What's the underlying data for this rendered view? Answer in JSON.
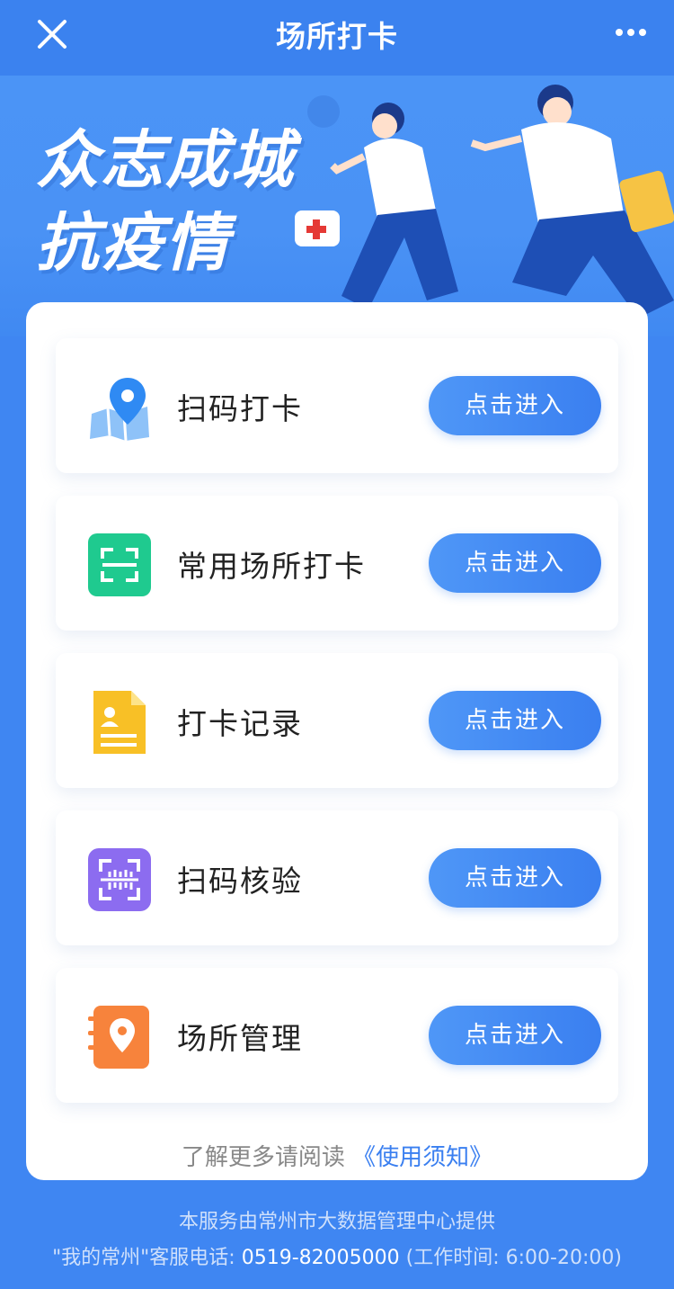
{
  "header": {
    "title": "场所打卡",
    "close_icon": "close-icon",
    "more_icon": "more-icon"
  },
  "banner": {
    "line1": "众志成城",
    "line2": "抗疫情"
  },
  "items": [
    {
      "label": "扫码打卡",
      "button": "点击进入",
      "icon": "map-pin-icon",
      "color": "#3d8ef5"
    },
    {
      "label": "常用场所打卡",
      "button": "点击进入",
      "icon": "scan-frame-icon",
      "color": "#1fca8f"
    },
    {
      "label": "打卡记录",
      "button": "点击进入",
      "icon": "document-icon",
      "color": "#f8c026"
    },
    {
      "label": "扫码核验",
      "button": "点击进入",
      "icon": "qr-verify-icon",
      "color": "#8c6cf0"
    },
    {
      "label": "场所管理",
      "button": "点击进入",
      "icon": "location-book-icon",
      "color": "#f7833c"
    }
  ],
  "notice": {
    "text": "了解更多请阅读",
    "link": "《使用须知》"
  },
  "footer": {
    "provider": "本服务由常州市大数据管理中心提供",
    "hotline_prefix": "\"我的常州\"客服电话: ",
    "phone": "0519-82005000",
    "hours": " (工作时间: 6:00-20:00)"
  }
}
